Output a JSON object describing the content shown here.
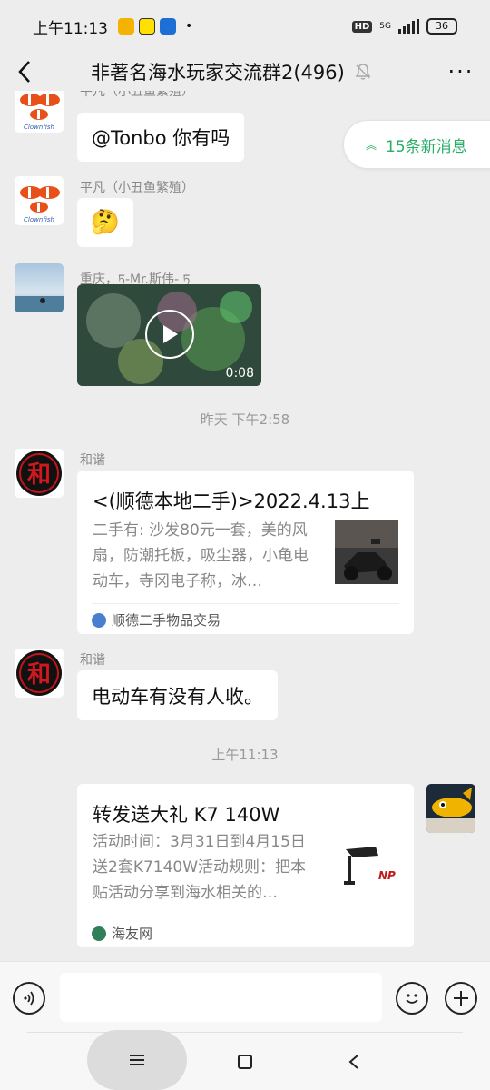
{
  "status_bar": {
    "time": "上午11:13",
    "network": "5G",
    "hd": "HD",
    "battery": "36"
  },
  "header": {
    "title": "非著名海水玩家交流群2(496)",
    "more": "···"
  },
  "new_messages": "15条新消息",
  "messages": [
    {
      "sender": "平凡（小丑鱼繁殖）",
      "text": "@Tonbo  你有吗"
    },
    {
      "sender": "平凡（小丑鱼繁殖）",
      "text": "🤔"
    },
    {
      "sender": "重庆，ཏ-Mr.斯伟- ཏ",
      "video_duration": "0:08"
    }
  ],
  "timestamp_1": "昨天 下午2:58",
  "card_1": {
    "sender": "和谐",
    "title": "<(顺德本地二手)>2022.4.13上",
    "desc": "二手有: 沙发80元一套，美的风扇，防潮托板，吸尘器，小龟电动车，寺冈电子称，冰…",
    "source": "顺德二手物品交易"
  },
  "message_4": {
    "sender": "和谐",
    "text": "电动车有没有人收。"
  },
  "timestamp_2": "上午11:13",
  "card_2": {
    "title": "转发送大礼 K7 140W",
    "desc": "活动时间：3月31日到4月15日送2套K7140W活动规则：把本贴活动分享到海水相关的…",
    "source": "海友网"
  },
  "avatar_text": "和",
  "colors": {
    "accent_green": "#2aae67",
    "background": "#ededed",
    "bubble": "#ffffff"
  }
}
